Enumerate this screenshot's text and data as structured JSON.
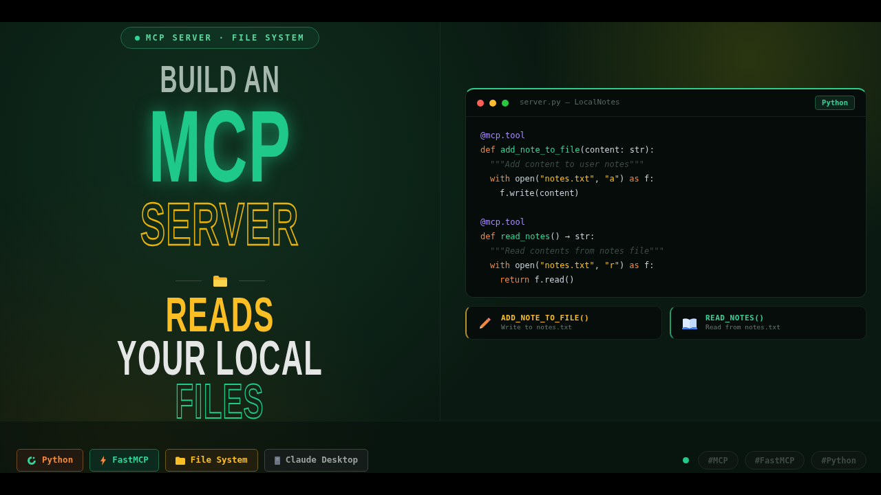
{
  "badge": {
    "text": "MCP SERVER · FILE SYSTEM"
  },
  "headline": [
    {
      "text": "BUILD AN",
      "kind": "muted"
    },
    {
      "text": "MCP",
      "kind": "glow"
    },
    {
      "text": "SERVER",
      "kind": "outline-gold"
    }
  ],
  "tagline": [
    {
      "text": "READS",
      "kind": "gold"
    },
    {
      "text": "YOUR LOCAL",
      "kind": "white"
    },
    {
      "text": "FILES",
      "kind": "outline-green"
    }
  ],
  "editor": {
    "title": "server.py — LocalNotes",
    "language": "Python",
    "blocks": [
      [
        {
          "tokens": [
            {
              "text": "@mcp.tool",
              "kind": "decorator"
            }
          ]
        },
        {
          "tokens": [
            {
              "text": "def ",
              "kind": "keyword"
            },
            {
              "text": "add_note_to_file",
              "kind": "function"
            },
            {
              "text": "(content: str):",
              "kind": "plain"
            }
          ],
          "children": [
            {
              "tokens": [
                {
                  "text": "\"\"\"Add content to user notes\"\"\"",
                  "kind": "comment"
                }
              ]
            },
            {
              "tokens": [
                {
                  "text": "with ",
                  "kind": "keyword"
                },
                {
                  "text": "open(",
                  "kind": "plain"
                },
                {
                  "text": "\"notes.txt\"",
                  "kind": "string"
                },
                {
                  "text": ", ",
                  "kind": "plain"
                },
                {
                  "text": "\"a\"",
                  "kind": "string"
                },
                {
                  "text": ") ",
                  "kind": "plain"
                },
                {
                  "text": "as",
                  "kind": "keyword"
                },
                {
                  "text": " f:",
                  "kind": "plain"
                }
              ],
              "children": [
                {
                  "tokens": [
                    {
                      "text": "f.write(content)",
                      "kind": "plain"
                    }
                  ]
                }
              ]
            }
          ]
        }
      ],
      [
        {
          "tokens": [
            {
              "text": "@mcp.tool",
              "kind": "decorator"
            }
          ]
        },
        {
          "tokens": [
            {
              "text": "def ",
              "kind": "keyword"
            },
            {
              "text": "read_notes",
              "kind": "function"
            },
            {
              "text": "() → str:",
              "kind": "plain"
            }
          ],
          "children": [
            {
              "tokens": [
                {
                  "text": "\"\"\"Read contents from notes file\"\"\"",
                  "kind": "comment"
                }
              ]
            },
            {
              "tokens": [
                {
                  "text": "with ",
                  "kind": "keyword"
                },
                {
                  "text": "open(",
                  "kind": "plain"
                },
                {
                  "text": "\"notes.txt\"",
                  "kind": "string"
                },
                {
                  "text": ", ",
                  "kind": "plain"
                },
                {
                  "text": "\"r\"",
                  "kind": "string"
                },
                {
                  "text": ") ",
                  "kind": "plain"
                },
                {
                  "text": "as",
                  "kind": "keyword"
                },
                {
                  "text": " f:",
                  "kind": "plain"
                }
              ],
              "children": [
                {
                  "tokens": [
                    {
                      "text": "return ",
                      "kind": "keyword"
                    },
                    {
                      "text": "f.read()",
                      "kind": "plain"
                    }
                  ]
                }
              ]
            }
          ]
        }
      ]
    ]
  },
  "tools": [
    {
      "name": "ADD_NOTE_TO_FILE()",
      "description": "Write to notes.txt",
      "kind": "write"
    },
    {
      "name": "READ_NOTES()",
      "description": "Read from notes.txt",
      "kind": "read"
    }
  ],
  "tech_tags": [
    {
      "label": "Python",
      "kind": "python"
    },
    {
      "label": "FastMCP",
      "kind": "fastmcp"
    },
    {
      "label": "File System",
      "kind": "files"
    },
    {
      "label": "Claude Desktop",
      "kind": "desktop"
    }
  ],
  "hashtags": [
    "#MCP",
    "#FastMCP",
    "#Python"
  ]
}
